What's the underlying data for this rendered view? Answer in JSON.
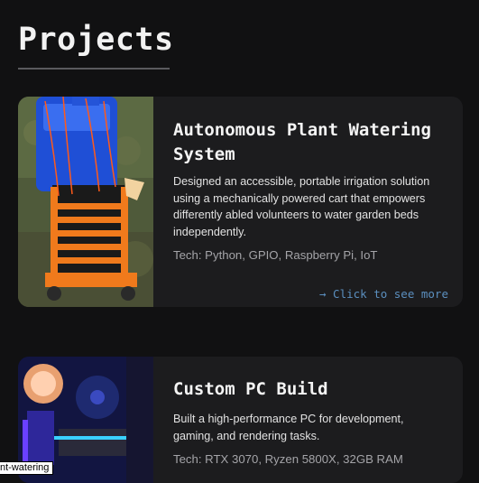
{
  "section": {
    "title": "Projects"
  },
  "projects": [
    {
      "title_line1": "Autonomous Plant Watering",
      "title_line2": "System",
      "description": "Designed an accessible, portable irrigation solution using a mechanically powered cart that empowers differently abled volunteers to water garden beds independently.",
      "tech": "Tech: Python, GPIO, Raspberry Pi, IoT",
      "link_label": "→ Click to see more"
    },
    {
      "title": "Custom PC Build",
      "description": "Built a high-performance PC for development, gaming, and rendering tasks.",
      "tech": "Tech: RTX 3070, Ryzen 5800X, 32GB RAM"
    }
  ],
  "tooltip": {
    "text": "nt-watering"
  },
  "colors": {
    "background": "#111112",
    "card": "#1c1c1e",
    "link": "#5b8fbf"
  }
}
